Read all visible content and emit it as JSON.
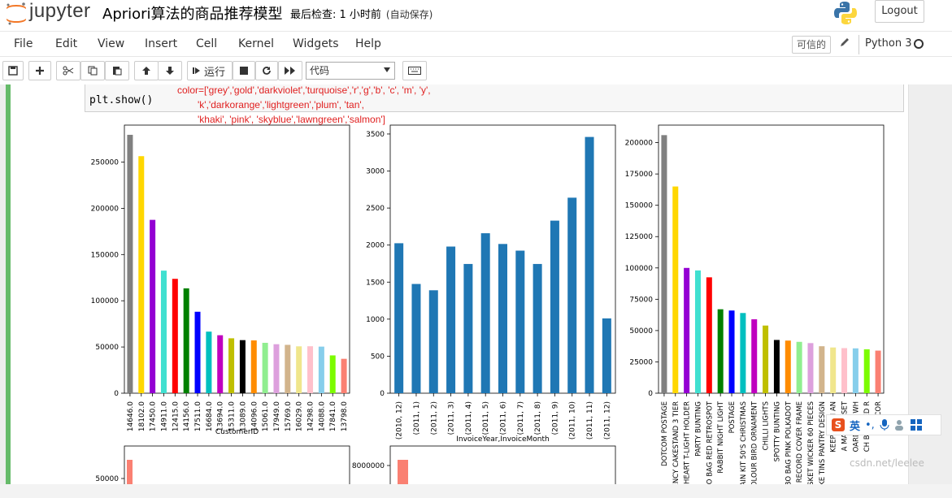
{
  "header": {
    "logo_text": "jupyter",
    "notebook_title": "Apriori算法的商品推荐模型",
    "checkpoint": "最后检查: 1 小时前",
    "autosave": "(自动保存)",
    "logout_label": "Logout"
  },
  "menubar": {
    "items": [
      "File",
      "Edit",
      "View",
      "Insert",
      "Cell",
      "Kernel",
      "Widgets",
      "Help"
    ],
    "trusted_label": "可信的",
    "kernel_name": "Python 3"
  },
  "toolbar": {
    "run_label": "运行",
    "cell_type": "代码"
  },
  "cell": {
    "code_line": "plt.show()",
    "overlay_lines": [
      "color=['grey','gold','darkviolet','turquoise','r','g','b', 'c', 'm', 'y',",
      "'k','darkorange','lightgreen','plum', 'tan',",
      "'khaki', 'pink', 'skyblue','lawngreen','salmon']"
    ]
  },
  "ime": {
    "label": "英"
  },
  "watermark": "csdn.net/leelee",
  "colors": {
    "palette": [
      "#808080",
      "#ffd700",
      "#9400d3",
      "#40e0d0",
      "#ff0000",
      "#008000",
      "#0000ff",
      "#00bfbf",
      "#bf00bf",
      "#bfbf00",
      "#000000",
      "#ff8c00",
      "#90ee90",
      "#dda0dd",
      "#d2b48c",
      "#f0e68c",
      "#ffc0cb",
      "#87ceeb",
      "#7cfc00",
      "#fa8072"
    ],
    "bar_blue": "#1f77b4",
    "cell_green": "#66bb6a"
  },
  "chart_data": [
    {
      "type": "bar",
      "xlabel": "CustomerID",
      "categories": [
        "14646.0",
        "18102.0",
        "17450.0",
        "14911.0",
        "12415.0",
        "14156.0",
        "17511.0",
        "16684.0",
        "13694.0",
        "15311.0",
        "13089.0",
        "14096.0",
        "15061.0",
        "17949.0",
        "15769.0",
        "16029.0",
        "14298.0",
        "14088.0",
        "17841.0",
        "13798.0"
      ],
      "values": [
        279500,
        256400,
        187500,
        132600,
        123700,
        113400,
        88100,
        66600,
        62700,
        59400,
        57400,
        57100,
        54500,
        53000,
        52300,
        50700,
        50800,
        50400,
        40900,
        37200
      ],
      "yticks": [
        0,
        50000,
        100000,
        150000,
        200000,
        250000
      ],
      "ylim": [
        0,
        290000
      ]
    },
    {
      "type": "bar",
      "xlabel": "InvoiceYear,InvoiceMonth",
      "categories": [
        "(2010, 12)",
        "(2011, 1)",
        "(2011, 2)",
        "(2011, 3)",
        "(2011, 4)",
        "(2011, 5)",
        "(2011, 6)",
        "(2011, 7)",
        "(2011, 8)",
        "(2011, 9)",
        "(2011, 10)",
        "(2011, 11)",
        "(2011, 12)"
      ],
      "values": [
        2025,
        1475,
        1390,
        1980,
        1745,
        2160,
        2015,
        1925,
        1745,
        2330,
        2640,
        3460,
        1010
      ],
      "yticks": [
        0,
        500,
        1000,
        1500,
        2000,
        2500,
        3000,
        3500
      ],
      "ylim": [
        0,
        3620
      ]
    },
    {
      "type": "bar",
      "xlabel": "",
      "categories": [
        "DOTCOM POSTAGE",
        "ENCY CAKESTAND 3 TIER",
        "HEART T-LIGHT HOLDER",
        "PARTY BUNTING",
        "BO BAG RED RETROSPOT",
        "RABBIT NIGHT LIGHT",
        "POSTAGE",
        "AIN KIT 50'S CHRISTMAS",
        "COLOUR BIRD ORNAMENT",
        "CHILLI LIGHTS",
        "SPOTTY BUNTING",
        "MBO BAG PINK POLKADOT",
        "RECORD COVER FRAME",
        "ASKET WICKER 60 PIECES",
        "KE TINS PANTRY DESIGN",
        "KEEP CALM AN",
        "A MAKING SET",
        "OARD ANT WH",
        "CH BAG RED R",
        "POPCOR"
      ],
      "values": [
        206000,
        165000,
        100000,
        98000,
        92500,
        67000,
        66000,
        64000,
        59000,
        54000,
        42500,
        42000,
        41000,
        40000,
        37500,
        36500,
        36000,
        35800,
        35000,
        34000
      ],
      "yticks": [
        0,
        25000,
        50000,
        75000,
        100000,
        125000,
        150000,
        175000,
        200000
      ],
      "ylim": [
        0,
        214000
      ]
    },
    {
      "type": "bar",
      "xlabel": "",
      "categories": [
        ""
      ],
      "values": [],
      "yticks": [
        50000
      ]
    },
    {
      "type": "bar",
      "xlabel": "",
      "categories": [
        ""
      ],
      "values": [],
      "yticks": [
        8000000
      ]
    }
  ]
}
